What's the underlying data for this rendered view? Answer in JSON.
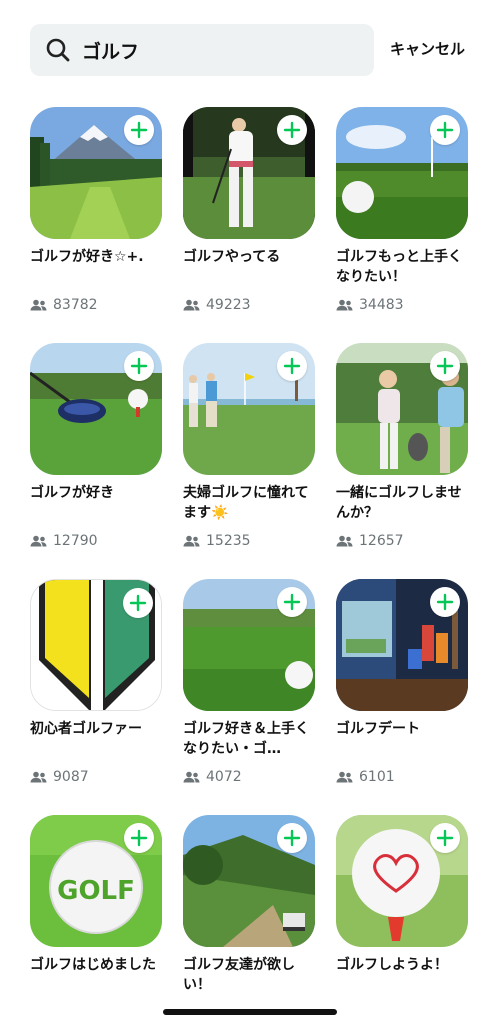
{
  "search": {
    "value": "ゴルフ",
    "cancel_label": "キャンセル"
  },
  "colors": {
    "accent": "#06c755"
  },
  "results": [
    {
      "title": "ゴルフが好き☆+.",
      "members": "83782",
      "art": "mountain-course"
    },
    {
      "title": "ゴルフやってる",
      "members": "49223",
      "art": "golfer-swing"
    },
    {
      "title": "ゴルフもっと上手くなりたい！",
      "members": "34483",
      "art": "ball-on-green"
    },
    {
      "title": "ゴルフが好き",
      "members": "12790",
      "art": "driver-ball"
    },
    {
      "title": "夫婦ゴルフに憧れてます☀️",
      "members": "15235",
      "art": "couple-course"
    },
    {
      "title": "一緒にゴルフしませんか？",
      "members": "12657",
      "art": "couple-smiling"
    },
    {
      "title": "初心者ゴルファー",
      "members": "9087",
      "art": "beginner-mark"
    },
    {
      "title": "ゴルフ好き＆上手くなりたい・ゴ…",
      "members": "4072",
      "art": "ball-on-grass"
    },
    {
      "title": "ゴルフデート",
      "members": "6101",
      "art": "bar-drinks"
    },
    {
      "title": "ゴルフはじめました",
      "members": "",
      "art": "golf-ball-logo",
      "logo_text": "GOLF"
    },
    {
      "title": "ゴルフ友達が欲しい！",
      "members": "",
      "art": "hillside-cart"
    },
    {
      "title": "ゴルフしようよ！",
      "members": "",
      "art": "heart-ball"
    }
  ]
}
